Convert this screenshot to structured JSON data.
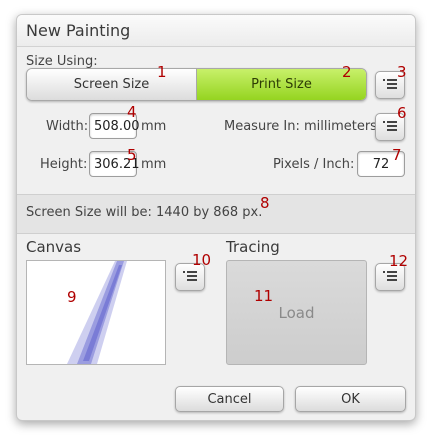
{
  "dialog": {
    "title": "New Painting"
  },
  "size_using": {
    "label": "Size Using:",
    "screen_size": "Screen Size",
    "print_size": "Print Size",
    "selected": "Print Size"
  },
  "width": {
    "label": "Width:",
    "value": "508.00",
    "unit": "mm"
  },
  "height": {
    "label": "Height:",
    "value": "306.21",
    "unit": "mm"
  },
  "measure": {
    "label": "Measure In: millimeters"
  },
  "ppi": {
    "label": "Pixels / Inch:",
    "value": "72"
  },
  "info": {
    "text": "Screen Size will be: 1440 by 868 px."
  },
  "canvas": {
    "title": "Canvas"
  },
  "tracing": {
    "title": "Tracing",
    "load_label": "Load"
  },
  "buttons": {
    "cancel": "Cancel",
    "ok": "OK"
  },
  "markers": {
    "m1": "1",
    "m2": "2",
    "m3": "3",
    "m4": "4",
    "m5": "5",
    "m6": "6",
    "m7": "7",
    "m8": "8",
    "m9": "9",
    "m10": "10",
    "m11": "11",
    "m12": "12"
  },
  "colors": {
    "accent_green": "#a6e032",
    "marker_red": "#b00000",
    "stroke_blue": "#3b3fc4"
  },
  "icons": {
    "menu": "list-menu-icon"
  }
}
